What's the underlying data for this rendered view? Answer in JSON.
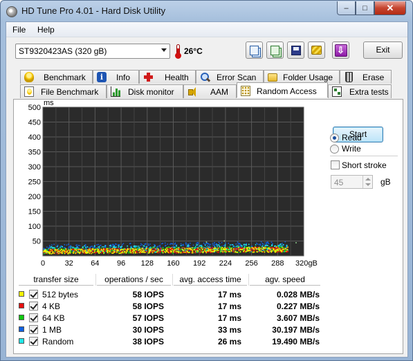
{
  "window": {
    "title": "HD Tune Pro 4.01 - Hard Disk Utility",
    "buttons": {
      "minimize": "–",
      "maximize": "□",
      "close": "✕"
    }
  },
  "menu": {
    "file": "File",
    "help": "Help"
  },
  "toolbar": {
    "drive": "ST9320423AS (320 gB)",
    "temperature": "26°C",
    "exit_label": "Exit",
    "icons": [
      "copy-text-icon",
      "copy-screenshot-icon",
      "save-icon",
      "options-icon",
      "download-icon"
    ],
    "download_glyph": "⇩"
  },
  "tabs": {
    "row1": [
      {
        "label": "Benchmark",
        "icon": "bulb-icon"
      },
      {
        "label": "Info",
        "icon": "info-icon"
      },
      {
        "label": "Health",
        "icon": "health-cross-icon"
      },
      {
        "label": "Error Scan",
        "icon": "magnifier-icon"
      },
      {
        "label": "Folder Usage",
        "icon": "folder-icon"
      },
      {
        "label": "Erase",
        "icon": "trash-icon"
      }
    ],
    "row2": [
      {
        "label": "File Benchmark",
        "icon": "file-bulb-icon"
      },
      {
        "label": "Disk monitor",
        "icon": "bar-graph-icon"
      },
      {
        "label": "AAM",
        "icon": "speaker-icon"
      },
      {
        "label": "Random Access",
        "icon": "random-dots-icon",
        "active": true
      },
      {
        "label": "Extra tests",
        "icon": "extra-grid-icon"
      }
    ],
    "info_glyph": "i"
  },
  "controls": {
    "start_label": "Start",
    "read_label": "Read",
    "write_label": "Write",
    "read_selected": true,
    "short_stroke_label": "Short stroke",
    "short_stroke_checked": false,
    "short_stroke_value": "45",
    "short_stroke_unit": "gB"
  },
  "chart_data": {
    "type": "scatter",
    "ylabel": "ms",
    "xunit": "gB",
    "xlim": [
      0,
      320
    ],
    "ylim": [
      0,
      500
    ],
    "xticks": [
      0,
      32,
      64,
      96,
      128,
      160,
      192,
      224,
      256,
      288,
      320
    ],
    "xtick_labels": [
      "0",
      "32",
      "64",
      "96",
      "128",
      "160",
      "192",
      "224",
      "256",
      "288",
      "320gB"
    ],
    "yticks": [
      50,
      100,
      150,
      200,
      250,
      300,
      350,
      400,
      450,
      500
    ],
    "grid": true,
    "background": "#2b2b2b",
    "series": [
      {
        "name": "512 bytes",
        "color": "#f5f500",
        "band_ms": [
          6,
          22
        ]
      },
      {
        "name": "4 KB",
        "color": "#e81010",
        "band_ms": [
          6,
          22
        ]
      },
      {
        "name": "64 KB",
        "color": "#10c810",
        "band_ms": [
          6,
          24
        ]
      },
      {
        "name": "1 MB",
        "color": "#1060e0",
        "band_ms": [
          12,
          38
        ]
      },
      {
        "name": "Random",
        "color": "#20e8e8",
        "band_ms": [
          8,
          32
        ]
      }
    ],
    "outliers_ms": [
      [
        222,
        52
      ],
      [
        200,
        48
      ],
      [
        310,
        46
      ]
    ]
  },
  "results": {
    "headers": [
      "transfer size",
      "operations / sec",
      "avg. access time",
      "agv. speed"
    ],
    "rows": [
      {
        "name": "512 bytes",
        "color": "#f5f500",
        "checked": true,
        "ops": "58 IOPS",
        "access": "17 ms",
        "speed": "0.028 MB/s"
      },
      {
        "name": "4 KB",
        "color": "#e81010",
        "checked": true,
        "ops": "58 IOPS",
        "access": "17 ms",
        "speed": "0.227 MB/s"
      },
      {
        "name": "64 KB",
        "color": "#10c810",
        "checked": true,
        "ops": "57 IOPS",
        "access": "17 ms",
        "speed": "3.607 MB/s"
      },
      {
        "name": "1 MB",
        "color": "#1060e0",
        "checked": true,
        "ops": "30 IOPS",
        "access": "33 ms",
        "speed": "30.197 MB/s"
      },
      {
        "name": "Random",
        "color": "#20e8e8",
        "checked": true,
        "ops": "38 IOPS",
        "access": "26 ms",
        "speed": "19.490 MB/s"
      }
    ]
  }
}
